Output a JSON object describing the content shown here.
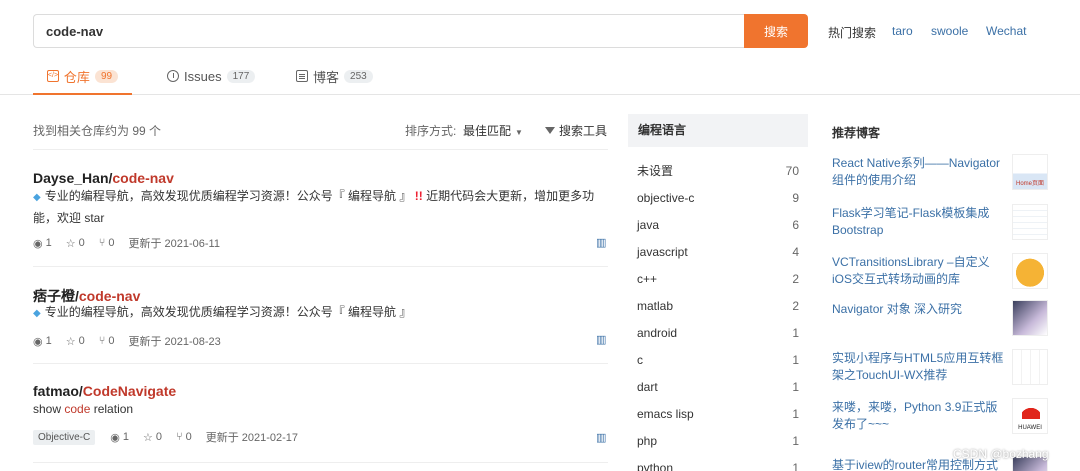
{
  "search": {
    "value": "code-nav",
    "button_label": "搜索",
    "hot_label": "热门搜索",
    "hot_links": [
      "taro",
      "swoole",
      "Wechat"
    ]
  },
  "tabs": [
    {
      "label": "仓库",
      "count": "99",
      "active": true,
      "icon": "code-icon"
    },
    {
      "label": "Issues",
      "count": "177",
      "active": false,
      "icon": "issue-icon"
    },
    {
      "label": "博客",
      "count": "253",
      "active": false,
      "icon": "blog-icon"
    }
  ],
  "results": {
    "count_text": "找到相关仓库约为 99 个",
    "sort_label": "排序方式:",
    "sort_value": "最佳匹配",
    "filter_label": "搜索工具"
  },
  "repos": [
    {
      "owner": "Dayse_Han/",
      "name": "code-nav",
      "desc_1": "专业的编程导航，高效发现优质编程学习资源！公众号『 编程导航 』",
      "desc_2": "近期代码会大更新，增加更多功能，欢迎 star",
      "lang": "",
      "watch": "1",
      "star": "0",
      "fork": "0",
      "updated": "更新于 2021-06-11"
    },
    {
      "owner": "痞子橙/",
      "name": "code-nav",
      "desc_1": "专业的编程导航，高效发现优质编程学习资源！公众号『 编程导航 』",
      "desc_2": "",
      "lang": "",
      "watch": "1",
      "star": "0",
      "fork": "0",
      "updated": "更新于 2021-08-23"
    },
    {
      "owner": "fatmao/",
      "name_hl": "Code",
      "name_rest": "Navigate",
      "desc_pre": "show ",
      "desc_hl": "code",
      "desc_post": " relation",
      "lang": "Objective-C",
      "watch": "1",
      "star": "0",
      "fork": "0",
      "updated": "更新于 2021-02-17"
    }
  ],
  "languages": {
    "header": "编程语言",
    "items": [
      {
        "name": "未设置",
        "count": "70"
      },
      {
        "name": "objective-c",
        "count": "9"
      },
      {
        "name": "java",
        "count": "6"
      },
      {
        "name": "javascript",
        "count": "4"
      },
      {
        "name": "c++",
        "count": "2"
      },
      {
        "name": "matlab",
        "count": "2"
      },
      {
        "name": "android",
        "count": "1"
      },
      {
        "name": "c",
        "count": "1"
      },
      {
        "name": "dart",
        "count": "1"
      },
      {
        "name": "emacs lisp",
        "count": "1"
      },
      {
        "name": "php",
        "count": "1"
      },
      {
        "name": "python",
        "count": "1"
      }
    ]
  },
  "blogs": {
    "header": "推荐博客",
    "items": [
      {
        "title": "React Native系列——Navigator组件的使用介绍",
        "thumb": "home-page-thumb",
        "thumb_text": "Home页面"
      },
      {
        "title": "Flask学习笔记-Flask模板集成Bootstrap",
        "thumb": "table-screenshot-thumb"
      },
      {
        "title": "VCTransitionsLibrary –自定义iOS交互式转场动画的库",
        "thumb": "cartoon-avatar-thumb"
      },
      {
        "title": "Navigator 对象 深入研究",
        "thumb": "anime-avatar-thumb"
      },
      {
        "title": "实现小程序与HTML5应用互转框架之TouchUI-WX推荐",
        "thumb": "grid-thumb"
      },
      {
        "title": "来喽，来喽，Python 3.9正式版发布了~~~",
        "thumb": "huawei-logo-thumb",
        "thumb_text": "HUAWEI"
      },
      {
        "title": "基于iview的router常用控制方式",
        "thumb": "anime-avatar-thumb"
      }
    ]
  },
  "watermark": "CSDN @bozhang",
  "colors": {
    "accent": "#f0742e",
    "link": "#3b70a6",
    "highlight": "#c0392b"
  }
}
